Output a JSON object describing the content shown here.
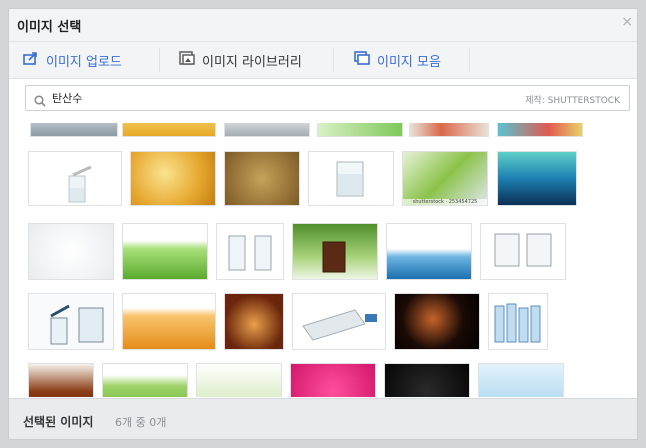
{
  "dialog": {
    "title": "이미지 선택",
    "close_glyph": "×"
  },
  "tabs": [
    {
      "label": "이미지 업로드",
      "icon": "upload-icon"
    },
    {
      "label": "이미지 라이브러리",
      "icon": "library-icon"
    },
    {
      "label": "이미지 모음",
      "icon": "collection-icon"
    }
  ],
  "search": {
    "value": "탄산수",
    "credit": "제작: SHUTTERSTOCK"
  },
  "gallery": {
    "thumbnails": [
      {
        "id": "r0a"
      },
      {
        "id": "r0b"
      },
      {
        "id": "r0c"
      },
      {
        "id": "r0d"
      },
      {
        "id": "r0e"
      },
      {
        "id": "r0f"
      },
      {
        "id": "r1a"
      },
      {
        "id": "r1b"
      },
      {
        "id": "r1c"
      },
      {
        "id": "r1d"
      },
      {
        "id": "r1e",
        "watermark": "shutterstock · 253454725"
      },
      {
        "id": "r1f"
      },
      {
        "id": "r2a"
      },
      {
        "id": "r2b"
      },
      {
        "id": "r2c"
      },
      {
        "id": "r2d"
      },
      {
        "id": "r2e"
      },
      {
        "id": "r2f"
      },
      {
        "id": "r3a"
      },
      {
        "id": "r3b"
      },
      {
        "id": "r3c"
      },
      {
        "id": "r3d"
      },
      {
        "id": "r3e"
      },
      {
        "id": "r3f"
      },
      {
        "id": "r4a"
      },
      {
        "id": "r4b"
      },
      {
        "id": "r4c"
      },
      {
        "id": "r4d"
      },
      {
        "id": "r4e"
      },
      {
        "id": "r4f"
      }
    ]
  },
  "footer": {
    "label": "선택된 이미지",
    "count": "6개 중 0개"
  },
  "colors": {
    "accent": "#3a6fd0",
    "panel": "#f3f4f6"
  }
}
